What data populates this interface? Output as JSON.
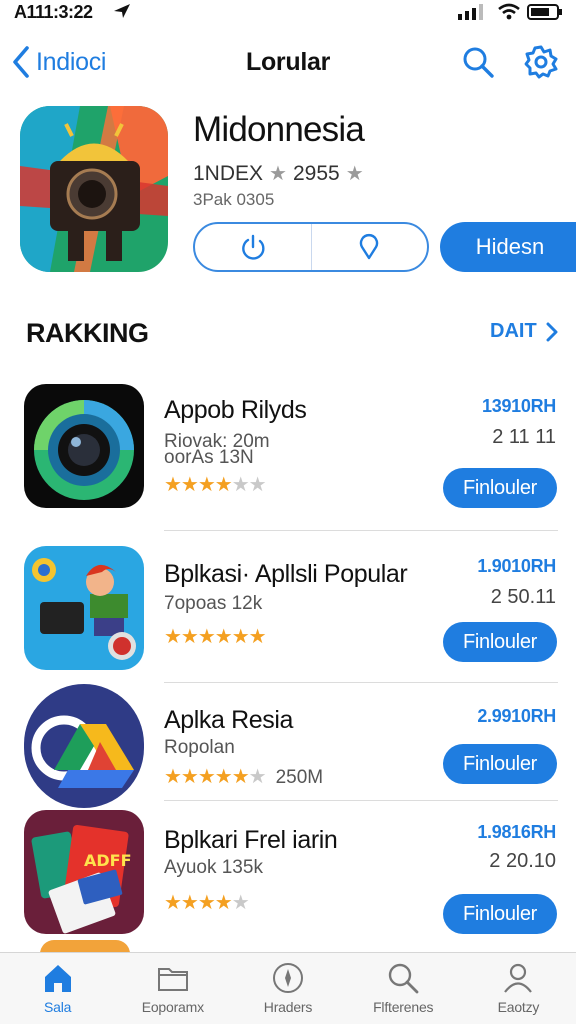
{
  "status_bar": {
    "time": "A111:3:22"
  },
  "nav": {
    "back_label": "Indioci",
    "title": "Lorular"
  },
  "hero": {
    "name": "Midonnesia",
    "meta_left": "1NDEX",
    "meta_right": "2955",
    "sub": "3Pak 0305",
    "action_label": "Hidesn"
  },
  "section": {
    "title": "RAKKING",
    "more_label": "DAIT"
  },
  "apps": [
    {
      "name": "Appob Rilyds",
      "sub_lines": [
        "Riovak: 20m",
        "oorAs 13N"
      ],
      "rating": 3.5,
      "extra": "",
      "price": "13910RH",
      "count": "2 11 11",
      "button": "Finlouler"
    },
    {
      "name": "Bplkasi· Apllsli Popular",
      "sub_lines": [
        "7opoas 12k"
      ],
      "rating": 5,
      "extra": "",
      "price": "1.9010RH",
      "count": "2 50.11",
      "button": "Finlouler"
    },
    {
      "name": "Aplka Resia",
      "sub_lines": [
        "Ropolan"
      ],
      "rating": 4.5,
      "extra": "250M",
      "price": "2.9910RH",
      "count": "",
      "button": "Finlouler"
    },
    {
      "name": "Bplkari Frel iarin",
      "sub_lines": [
        "Ayuok 135k"
      ],
      "rating": 4,
      "extra": "",
      "price": "1.9816RH",
      "count": "2 20.10",
      "button": "Finlouler"
    }
  ],
  "tabs": [
    {
      "label": "Sala",
      "icon": "home-icon",
      "active": true
    },
    {
      "label": "Eoporamx",
      "icon": "folder-icon",
      "active": false
    },
    {
      "label": "Hraders",
      "icon": "compass-icon",
      "active": false
    },
    {
      "label": "Flfterenes",
      "icon": "search-icon",
      "active": false
    },
    {
      "label": "Eaotzy",
      "icon": "person-icon",
      "active": false
    }
  ],
  "colors": {
    "accent": "#1f7de0",
    "star": "#f4a021"
  }
}
